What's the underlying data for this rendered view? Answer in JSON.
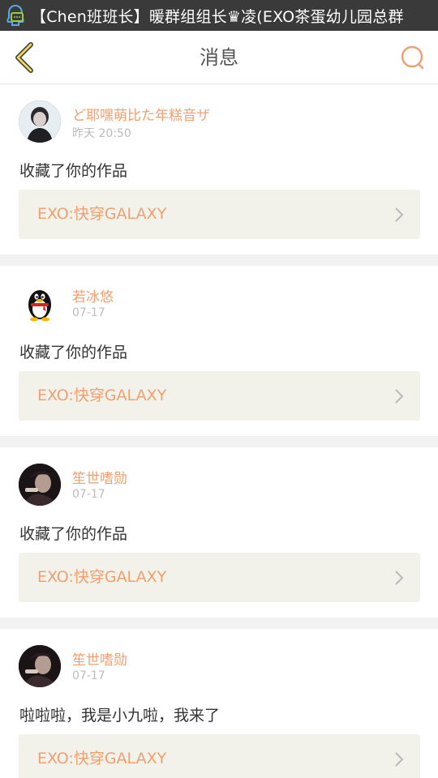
{
  "status_bar": {
    "notification_text": "【Chen班班长】暖群组组长♛凌(EXO茶蛋幼儿园总群",
    "icon": "qq-notification-icon"
  },
  "header": {
    "title": "消息",
    "back_icon": "chevron-left-icon",
    "search_icon": "search-icon",
    "accent_color": "#f0a070"
  },
  "messages": [
    {
      "user": "ど耶嘿萌比た年糕音ザ",
      "time": "昨天 20:50",
      "text": "收藏了你的作品",
      "work_title": "EXO:快穿GALAXY",
      "avatar": "photo"
    },
    {
      "user": "若冰悠",
      "time": "07-17",
      "text": "收藏了你的作品",
      "work_title": "EXO:快穿GALAXY",
      "avatar": "qq-penguin"
    },
    {
      "user": "笙世嗜勋",
      "time": "07-17",
      "text": "收藏了你的作品",
      "work_title": "EXO:快穿GALAXY",
      "avatar": "photo"
    },
    {
      "user": "笙世嗜勋",
      "time": "07-17",
      "text": "啦啦啦，我是小九啦，我来了",
      "work_title": "EXO:快穿GALAXY",
      "avatar": "photo"
    }
  ]
}
